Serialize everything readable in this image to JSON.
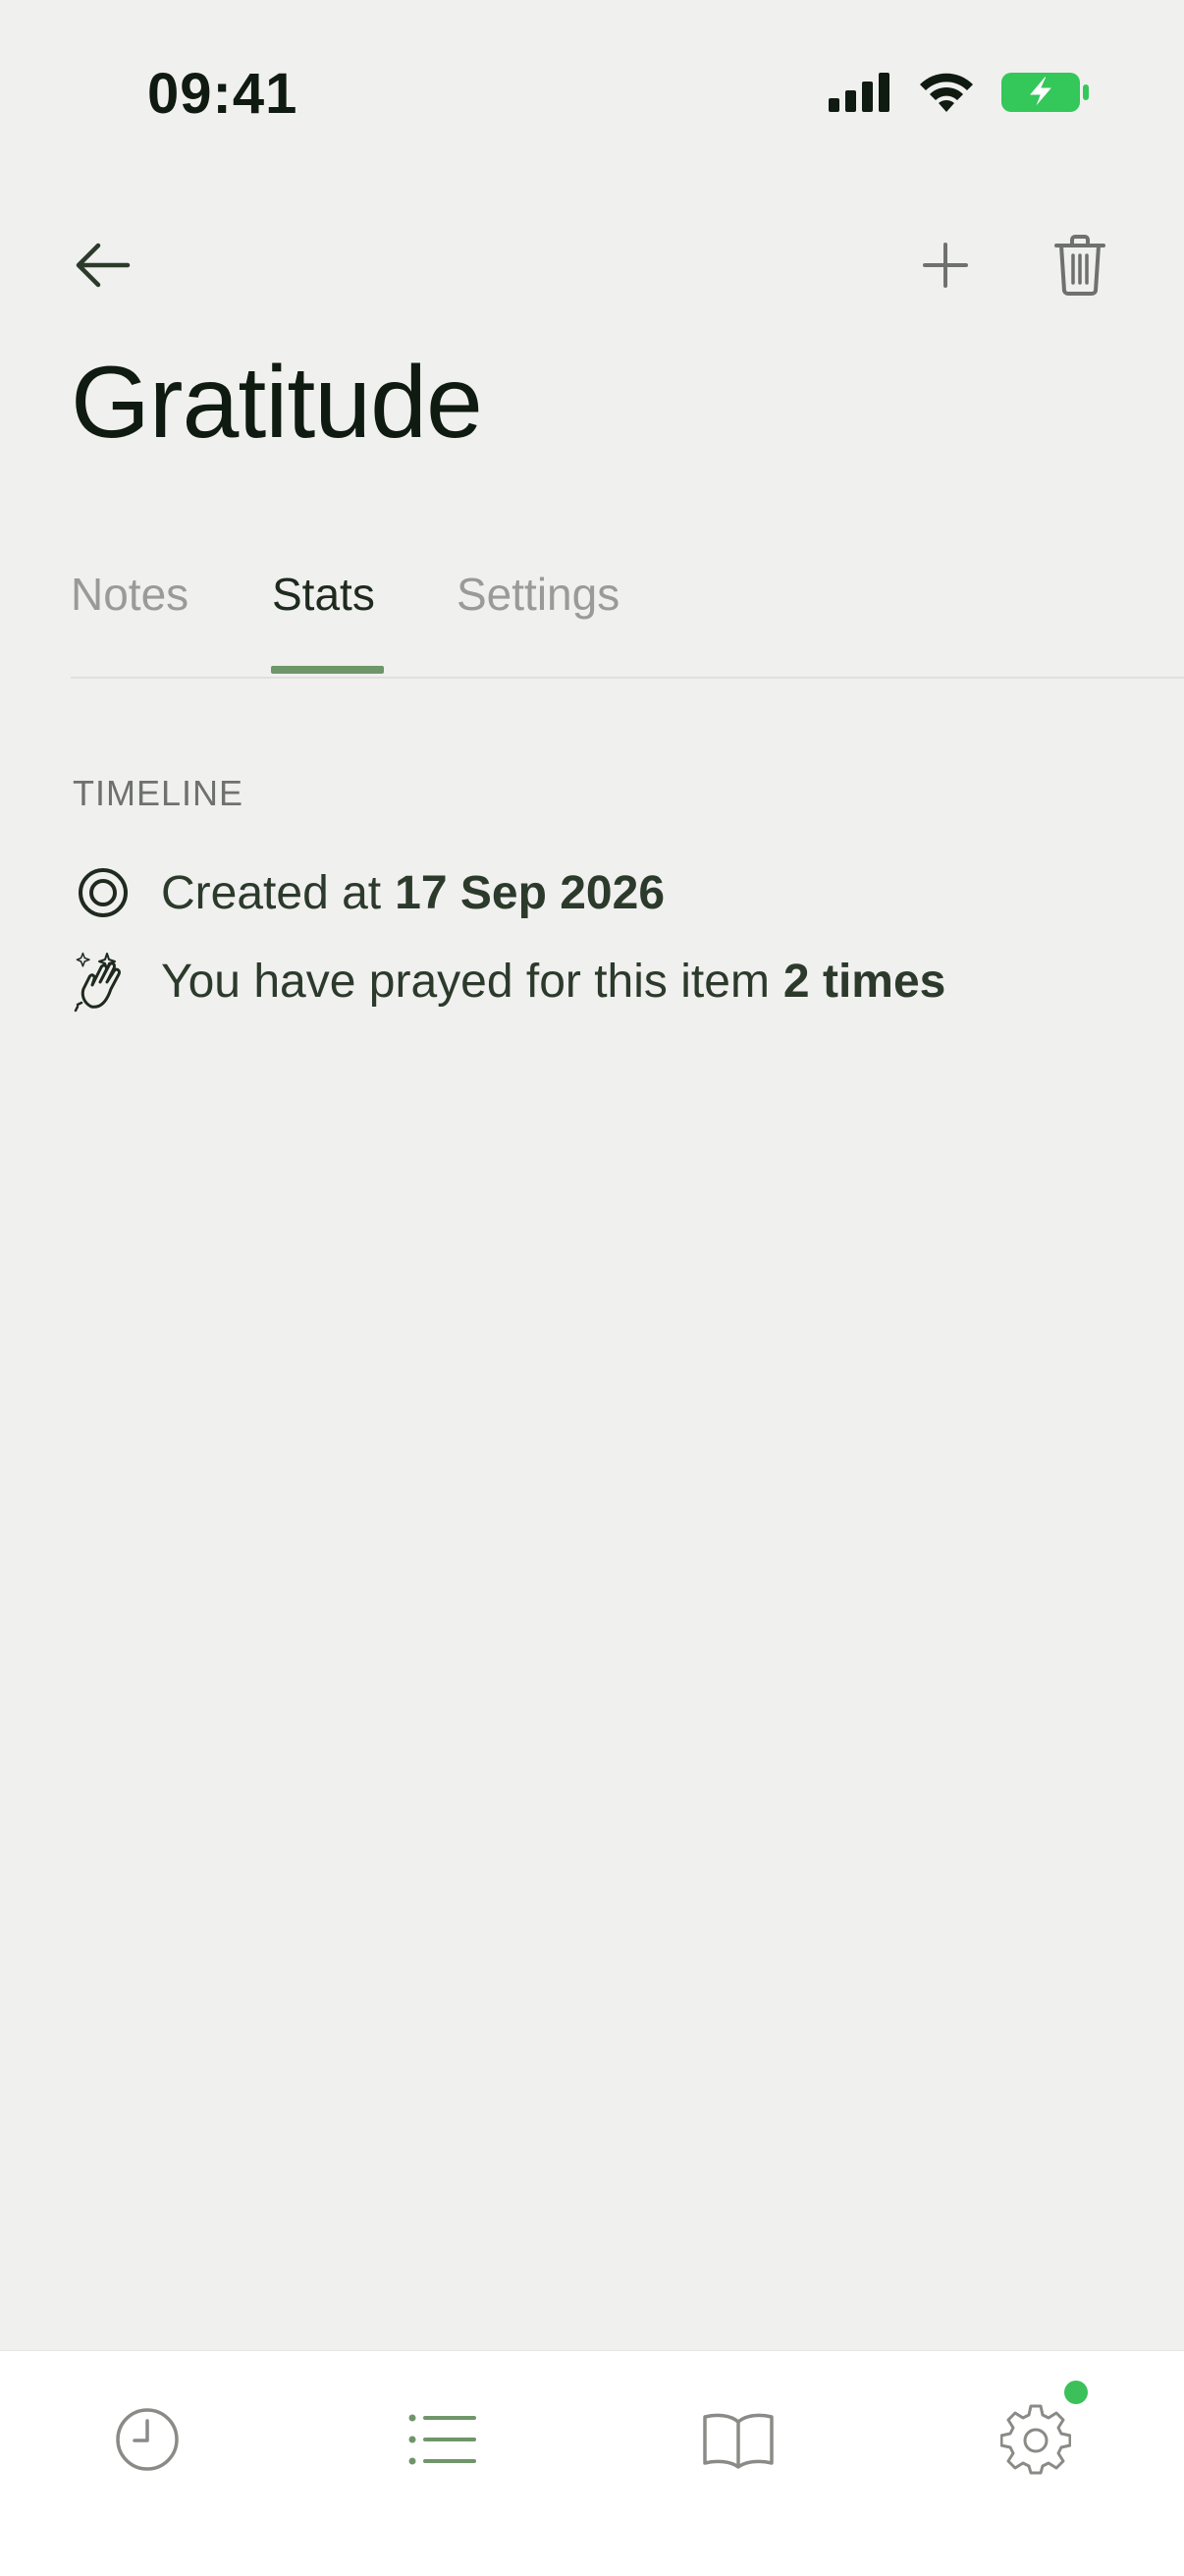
{
  "status_bar": {
    "time": "09:41",
    "icons": [
      "cellular-signal-icon",
      "wifi-icon",
      "battery-charging-icon"
    ],
    "battery_color": "#34c759"
  },
  "nav": {
    "icons": [
      "arrow-left-icon",
      "plus-icon",
      "trash-icon"
    ]
  },
  "page": {
    "title": "Gratitude"
  },
  "tabs": {
    "items": [
      {
        "label": "Notes",
        "active": false
      },
      {
        "label": "Stats",
        "active": true
      },
      {
        "label": "Settings",
        "active": false
      }
    ],
    "accent_color": "#6f9669"
  },
  "timeline": {
    "section_label": "TIMELINE",
    "created_prefix": "Created at",
    "created_date": "17 Sep 2026",
    "prayed_prefix": "You have prayed for this item",
    "prayed_count": "2 times",
    "icons": [
      "target-icon",
      "praying-hands-icon"
    ]
  },
  "tab_bar": {
    "icons": [
      "clock-icon",
      "list-icon",
      "book-icon",
      "gear-icon"
    ],
    "active": "list-icon",
    "notification_dot_color": "#3cc05a"
  }
}
